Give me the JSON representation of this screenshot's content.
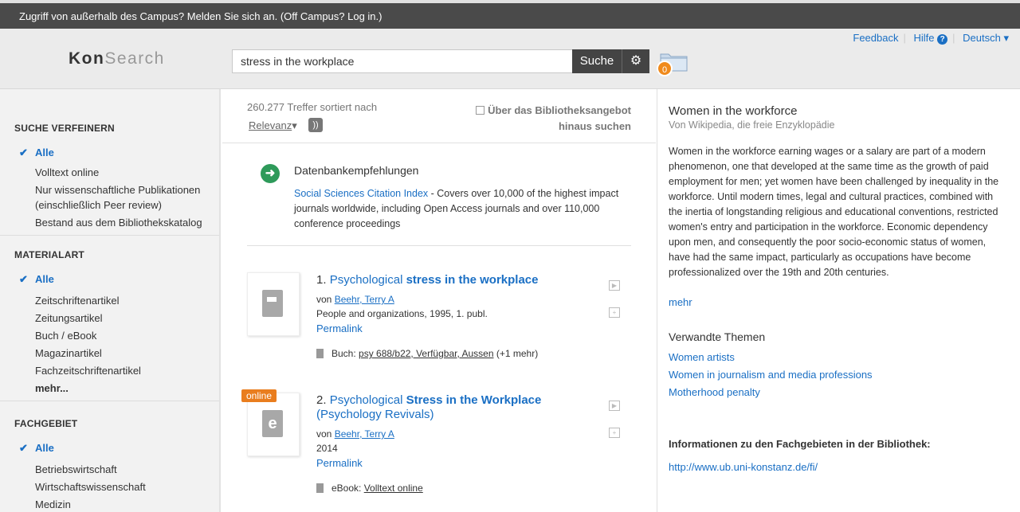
{
  "topbar": {
    "text": "Zugriff von außerhalb des Campus? Melden Sie sich an. (Off Campus? Log in.)"
  },
  "header": {
    "logo_kon": "Kon",
    "logo_search": "Search",
    "search_value": "stress in the workplace",
    "search_button": "Suche",
    "folder_count": "0",
    "links": {
      "feedback": "Feedback",
      "help": "Hilfe",
      "language": "Deutsch"
    }
  },
  "sidebar": {
    "facets": [
      {
        "title": "SUCHE VERFEINERN",
        "items": [
          "Alle",
          "Volltext online",
          "Nur wissenschaftliche Publikationen (einschließlich Peer review)",
          "Bestand aus dem Bibliothekskatalog"
        ]
      },
      {
        "title": "MATERIALART",
        "items": [
          "Alle",
          "Zeitschriftenartikel",
          "Zeitungsartikel",
          "Buch / eBook",
          "Magazinartikel",
          "Fachzeitschriftenartikel",
          "mehr..."
        ]
      },
      {
        "title": "FACHGEBIET",
        "items": [
          "Alle",
          "Betriebswirtschaft",
          "Wirtschaftswissenschaft",
          "Medizin"
        ]
      }
    ]
  },
  "results": {
    "count": "260.277 Treffer sortiert nach",
    "sort": "Relevanz",
    "beyond_label": "Über das Bibliotheksangebot hinaus suchen",
    "db_rec": {
      "title": "Datenbankempfehlungen",
      "link": "Social Sciences Citation Index",
      "desc": " - Covers over 10,000 of the highest impact journals worldwide, including Open Access journals and over 110,000 conference proceedings"
    },
    "items": [
      {
        "num": "1.",
        "title_pre": "Psychological ",
        "title_bold": "stress in the workplace",
        "title_post": "",
        "by_label": "von",
        "author": "Beehr, Terry A",
        "pub": "People and organizations, 1995, 1. publ.",
        "permalink": "Permalink",
        "holding_label": "Buch:",
        "holding_link": "psy 688/b22, Verfügbar, Aussen",
        "holding_extra": "(+1 mehr)"
      },
      {
        "num": "2.",
        "title_pre": "Psychological ",
        "title_bold": "Stress in the Workplace",
        "title_post": " (Psychology Revivals)",
        "online": "online",
        "by_label": "von",
        "author": "Beehr, Terry A",
        "pub": "2014",
        "permalink": "Permalink",
        "holding_label": "eBook:",
        "holding_link": "Volltext online",
        "holding_extra": ""
      }
    ]
  },
  "wiki": {
    "title": "Women in the workforce",
    "subtitle": "Von Wikipedia, die freie Enzyklopädie",
    "text": "Women in the workforce earning wages or a salary are part of a modern phenomenon, one that developed at the same time as the growth of paid employment for men; yet women have been challenged by inequality in the workforce. Until modern times, legal and cultural practices, combined with the inertia of longstanding religious and educational conventions, restricted women's entry and participation in the workforce. Economic dependency upon men, and consequently the poor socio-economic status of women, have had the same impact, particularly as occupations have become professionalized over the 19th and 20th centuries.",
    "more": "mehr",
    "related_title": "Verwandte Themen",
    "related": [
      "Women artists",
      "Women in journalism and media professions",
      "Motherhood penalty"
    ],
    "info_title": "Informationen zu den Fachgebieten in der Bibliothek:",
    "info_link": "http://www.ub.uni-konstanz.de/fi/"
  }
}
